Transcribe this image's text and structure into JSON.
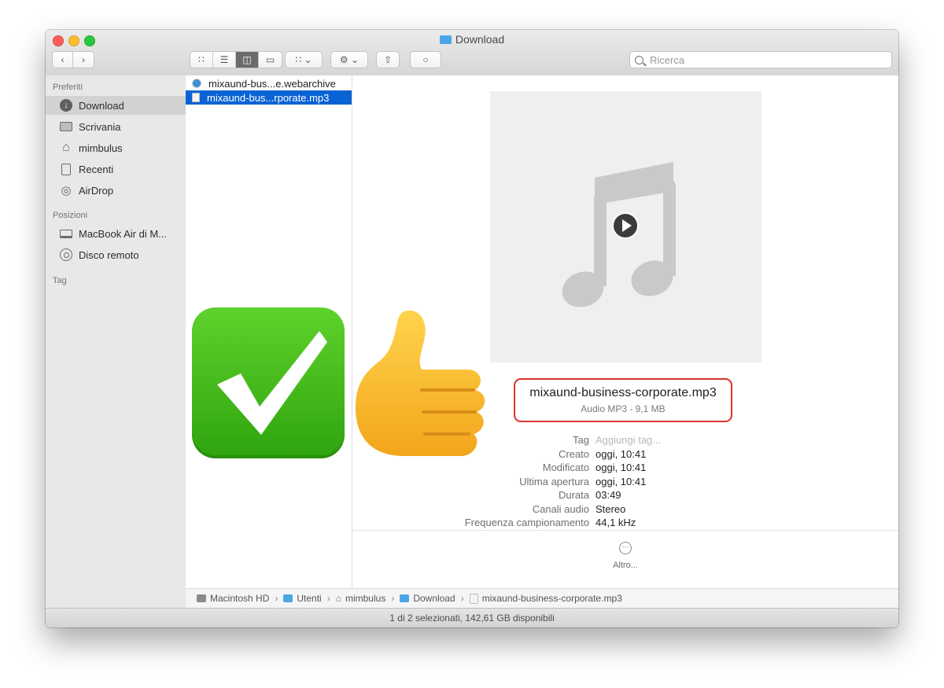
{
  "window": {
    "title": "Download"
  },
  "toolbar": {
    "view_modes": [
      "icons",
      "list",
      "columns",
      "gallery"
    ],
    "active_view": "columns",
    "search_placeholder": "Ricerca"
  },
  "sidebar": {
    "favorites_header": "Preferiti",
    "favorites": [
      {
        "label": "Download",
        "icon": "download-icon",
        "selected": true
      },
      {
        "label": "Scrivania",
        "icon": "desktop-icon"
      },
      {
        "label": "mimbulus",
        "icon": "home-icon"
      },
      {
        "label": "Recenti",
        "icon": "recents-icon"
      },
      {
        "label": "AirDrop",
        "icon": "airdrop-icon"
      }
    ],
    "locations_header": "Posizioni",
    "locations": [
      {
        "label": "MacBook Air di M...",
        "icon": "laptop-icon"
      },
      {
        "label": "Disco remoto",
        "icon": "disc-icon"
      }
    ],
    "tags_header": "Tag"
  },
  "files": [
    {
      "name": "mixaund-bus...e.webarchive",
      "selected": false
    },
    {
      "name": "mixaund-bus...rporate.mp3",
      "selected": true
    }
  ],
  "preview": {
    "filename": "mixaund-business-corporate.mp3",
    "kind": "Audio MP3 - 9,1 MB",
    "meta": [
      {
        "key": "Tag",
        "value": "Aggiungi tag...",
        "placeholder": true
      },
      {
        "key": "Creato",
        "value": "oggi, 10:41"
      },
      {
        "key": "Modificato",
        "value": "oggi, 10:41"
      },
      {
        "key": "Ultima apertura",
        "value": "oggi, 10:41"
      },
      {
        "key": "Durata",
        "value": "03:49"
      },
      {
        "key": "Canali audio",
        "value": "Stereo"
      },
      {
        "key": "Frequenza campionamento",
        "value": "44,1 kHz"
      }
    ],
    "more_label": "Altro..."
  },
  "pathbar": [
    "Macintosh HD",
    "Utenti",
    "mimbulus",
    "Download",
    "mixaund-business-corporate.mp3"
  ],
  "status": "1 di 2 selezionati, 142,61 GB disponibili",
  "colors": {
    "selection": "#0a63d4",
    "highlight_box": "#d9342b"
  }
}
